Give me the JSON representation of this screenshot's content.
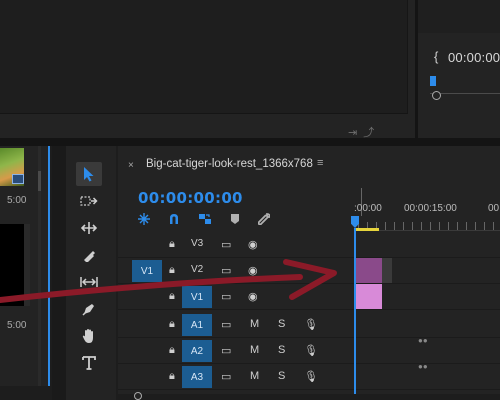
{
  "program_monitor": {
    "timecode": "00:00:00",
    "marker_glyph": "{"
  },
  "project_panel": {
    "items": [
      {
        "duration": "5:00"
      },
      {
        "duration": "5:00"
      }
    ]
  },
  "timeline": {
    "sequence_name": "Big-cat-tiger-look-rest_1366x768",
    "close_glyph": "×",
    "menu_glyph": "≡",
    "timecode": "00:00:00:00",
    "ruler_labels": [
      ":00:00",
      "00:00:15:00",
      "00"
    ],
    "video_tracks": [
      {
        "name": "V3",
        "source": ""
      },
      {
        "name": "V2",
        "source": "V1"
      },
      {
        "name": "V1",
        "source": ""
      }
    ],
    "audio_tracks": [
      {
        "name": "A1",
        "mute": "M",
        "solo": "S"
      },
      {
        "name": "A2",
        "mute": "M",
        "solo": "S"
      },
      {
        "name": "A3",
        "mute": "M",
        "solo": "S"
      }
    ]
  },
  "tools": [
    "selection-tool",
    "track-select-tool",
    "ripple-edit-tool",
    "razor-tool",
    "slip-tool",
    "pen-tool",
    "hand-tool",
    "type-tool"
  ],
  "colors": {
    "accent": "#2d8ceb",
    "track_target": "#1c5d92",
    "clip_pink": "#d88ad8",
    "clip_purple": "#8a4a8a",
    "work_area": "#e6d43c",
    "annotation_arrow": "#8b1a28"
  }
}
